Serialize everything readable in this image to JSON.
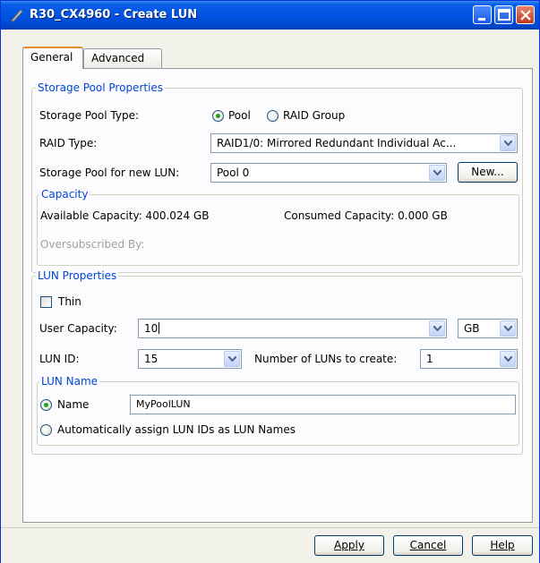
{
  "window": {
    "title": "R30_CX4960 - Create LUN"
  },
  "tabs": [
    {
      "label": "General"
    },
    {
      "label": "Advanced"
    }
  ],
  "storage_pool": {
    "legend": "Storage Pool Properties",
    "type_label": "Storage Pool Type:",
    "type_options": {
      "pool": "Pool",
      "raid_group": "RAID Group",
      "selected": "Pool"
    },
    "raid_type_label": "RAID Type:",
    "raid_type_value": "RAID1/0: Mirrored Redundant Individual Ac...",
    "pool_for_lun_label": "Storage Pool for new LUN:",
    "pool_for_lun_value": "Pool 0",
    "new_button": "New..."
  },
  "capacity": {
    "legend": "Capacity",
    "available": "Available Capacity: 400.024 GB",
    "consumed": "Consumed Capacity: 0.000 GB",
    "oversubscribed": "Oversubscribed By:"
  },
  "lun_properties": {
    "legend": "LUN Properties",
    "thin_label": "Thin",
    "thin_checked": false,
    "user_capacity_label": "User Capacity:",
    "user_capacity_value": "10",
    "unit_value": "GB",
    "lun_id_label": "LUN ID:",
    "lun_id_value": "15",
    "num_luns_label": "Number of LUNs to create:",
    "num_luns_value": "1"
  },
  "lun_name": {
    "legend": "LUN Name",
    "name_option": "Name",
    "name_value": "MyPoolLUN",
    "auto_option": "Automatically assign LUN IDs as LUN Names",
    "selected": "Name"
  },
  "buttons": {
    "apply": "Apply",
    "cancel": "Cancel",
    "help": "Help"
  }
}
